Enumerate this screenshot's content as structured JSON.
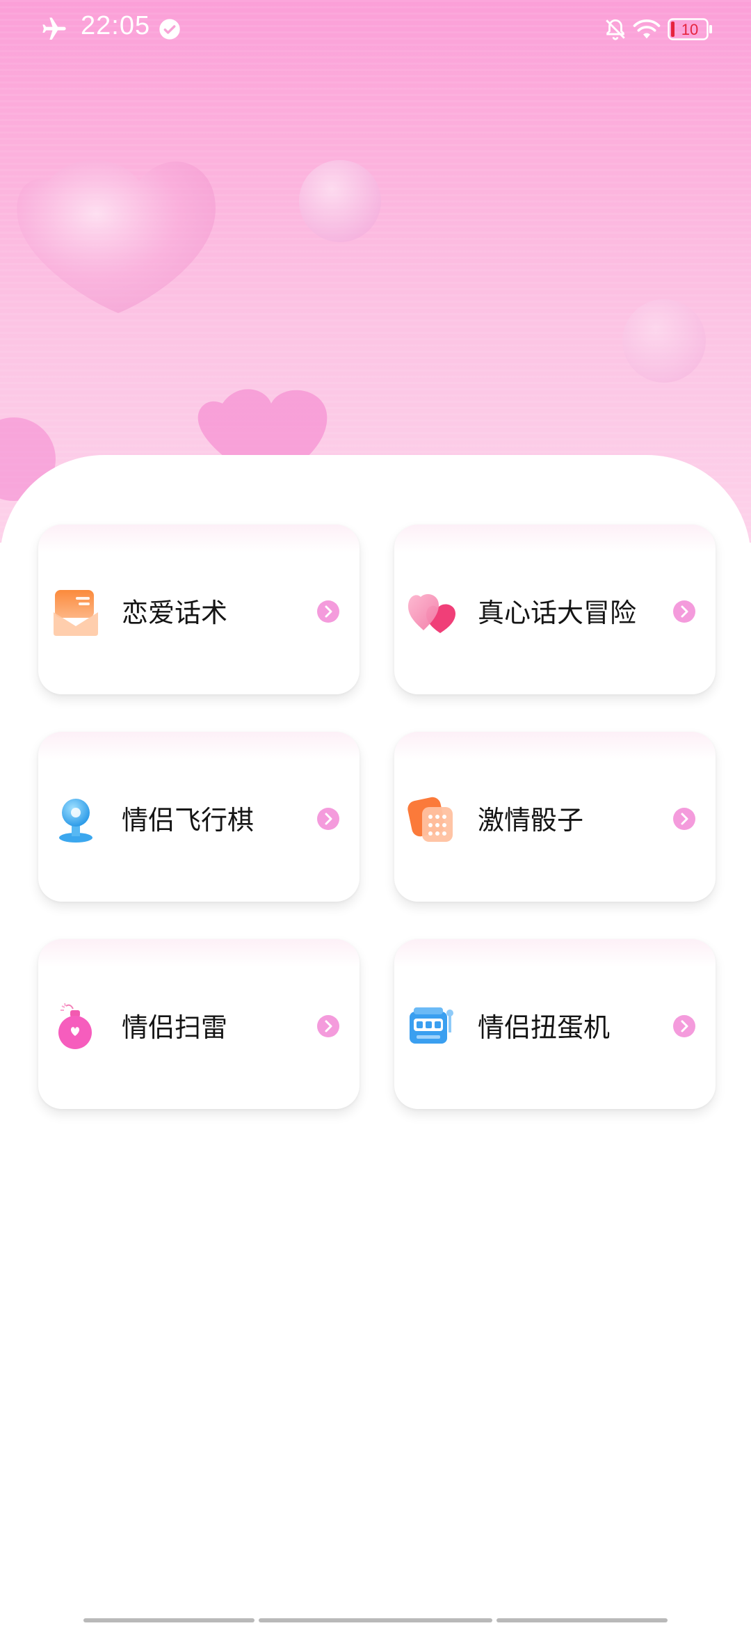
{
  "status_bar": {
    "time": "22:05",
    "battery": "10",
    "icons": [
      "airplane-mode-icon",
      "verified-check-icon",
      "bell-muted-icon",
      "wifi-icon",
      "battery-icon"
    ]
  },
  "games": [
    {
      "label": "恋爱话术",
      "icon": "envelope-icon"
    },
    {
      "label": "真心话大冒险",
      "icon": "hearts-icon"
    },
    {
      "label": "情侣飞行棋",
      "icon": "chess-piece-icon"
    },
    {
      "label": "激情骰子",
      "icon": "dice-icon"
    },
    {
      "label": "情侣扫雷",
      "icon": "heart-bomb-icon"
    },
    {
      "label": "情侣扭蛋机",
      "icon": "slot-machine-icon"
    }
  ],
  "colors": {
    "hero_top": "#fb9fd8",
    "hero_bottom": "#fdd2ea",
    "arrow": "#f07ad0",
    "card_text": "#141414"
  }
}
